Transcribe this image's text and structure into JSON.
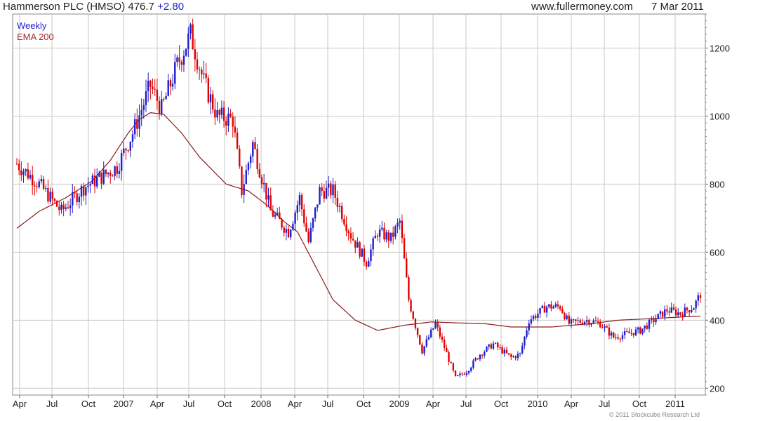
{
  "header": {
    "title_main": "Hammerson PLC (HMSO) 476.7",
    "title_change": "+2.80",
    "site": "www.fullermoney.com",
    "date": "7 Mar 2011"
  },
  "legend": {
    "series1": "Weekly",
    "series2": "EMA 200"
  },
  "copyright": "© 2011 Stockcube Research Ltd",
  "colors": {
    "up": "#1f1fcc",
    "down": "#e00000",
    "ema": "#8b1a1a",
    "grid": "#c8c8c8"
  },
  "chart_data": {
    "type": "candlestick",
    "title": "Hammerson PLC (HMSO) 476.7 +2.80",
    "ylim": [
      180,
      1300
    ],
    "yticks": [
      200,
      400,
      600,
      800,
      1000,
      1200
    ],
    "xticks": [
      "Apr",
      "Jul",
      "Oct",
      "2007",
      "Apr",
      "Jul",
      "Oct",
      "2008",
      "Apr",
      "Jul",
      "Oct",
      "2009",
      "Apr",
      "Jul",
      "Oct",
      "2010",
      "Apr",
      "Jul",
      "Oct",
      "2011"
    ],
    "grid": true,
    "last_close": 476.7,
    "series": [
      {
        "name": "Weekly",
        "price_path": [
          [
            0,
            860
          ],
          [
            10,
            800
          ],
          [
            20,
            720
          ],
          [
            30,
            790
          ],
          [
            45,
            850
          ],
          [
            52,
            950
          ],
          [
            60,
            1090
          ],
          [
            65,
            1020
          ],
          [
            72,
            1150
          ],
          [
            78,
            1240
          ],
          [
            84,
            1100
          ],
          [
            90,
            1000
          ],
          [
            97,
            990
          ],
          [
            101,
            780
          ],
          [
            106,
            920
          ],
          [
            114,
            720
          ],
          [
            122,
            660
          ],
          [
            127,
            760
          ],
          [
            131,
            630
          ],
          [
            136,
            780
          ],
          [
            142,
            780
          ],
          [
            150,
            650
          ],
          [
            157,
            570
          ],
          [
            162,
            660
          ],
          [
            168,
            640
          ],
          [
            172,
            690
          ],
          [
            176,
            460
          ],
          [
            182,
            310
          ],
          [
            188,
            390
          ],
          [
            192,
            320
          ],
          [
            197,
            230
          ],
          [
            202,
            250
          ],
          [
            208,
            300
          ],
          [
            214,
            330
          ],
          [
            222,
            290
          ],
          [
            226,
            300
          ],
          [
            230,
            400
          ],
          [
            238,
            440
          ],
          [
            244,
            440
          ],
          [
            248,
            390
          ],
          [
            256,
            400
          ],
          [
            262,
            390
          ],
          [
            268,
            350
          ],
          [
            274,
            360
          ],
          [
            280,
            370
          ],
          [
            286,
            400
          ],
          [
            292,
            430
          ],
          [
            298,
            420
          ],
          [
            304,
            440
          ],
          [
            307,
            477
          ]
        ]
      },
      {
        "name": "EMA 200",
        "values": [
          [
            0,
            670
          ],
          [
            10,
            720
          ],
          [
            22,
            760
          ],
          [
            34,
            810
          ],
          [
            42,
            870
          ],
          [
            50,
            950
          ],
          [
            55,
            990
          ],
          [
            60,
            1010
          ],
          [
            66,
            1005
          ],
          [
            74,
            950
          ],
          [
            82,
            880
          ],
          [
            94,
            800
          ],
          [
            104,
            780
          ],
          [
            112,
            740
          ],
          [
            120,
            690
          ],
          [
            126,
            660
          ],
          [
            134,
            560
          ],
          [
            142,
            460
          ],
          [
            152,
            400
          ],
          [
            162,
            370
          ],
          [
            174,
            385
          ],
          [
            186,
            395
          ],
          [
            198,
            392
          ],
          [
            210,
            390
          ],
          [
            222,
            380
          ],
          [
            240,
            380
          ],
          [
            258,
            390
          ],
          [
            270,
            400
          ],
          [
            286,
            405
          ],
          [
            300,
            410
          ],
          [
            307,
            412
          ]
        ]
      }
    ]
  }
}
